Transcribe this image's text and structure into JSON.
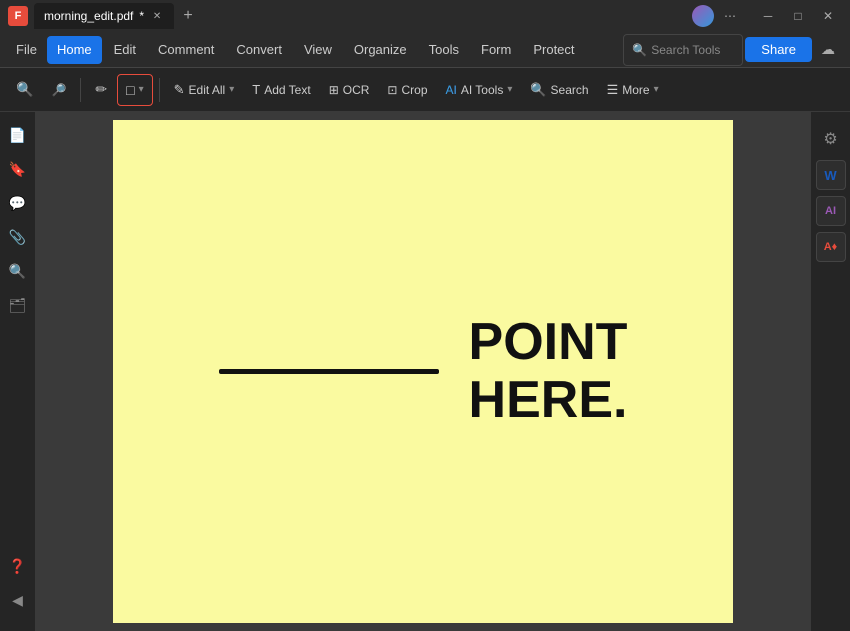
{
  "titlebar": {
    "app_logo": "F",
    "tab_name": "morning_edit.pdf",
    "tab_modified": "*",
    "new_tab_label": "+",
    "avatar_label": "user-avatar",
    "more_options_label": "⋯",
    "minimize_label": "─",
    "maximize_label": "□",
    "close_label": "✕"
  },
  "menubar": {
    "file_label": "File",
    "home_label": "Home",
    "edit_label": "Edit",
    "comment_label": "Comment",
    "convert_label": "Convert",
    "view_label": "View",
    "organize_label": "Organize",
    "tools_label": "Tools",
    "form_label": "Form",
    "protect_label": "Protect",
    "search_placeholder": "Search Tools",
    "share_label": "Share"
  },
  "toolbar": {
    "zoom_in_icon": "🔍",
    "zoom_out_icon": "🔎",
    "highlight_icon": "✏",
    "shape_icon": "□",
    "edit_all_label": "Edit All",
    "add_text_label": "Add Text",
    "ocr_label": "OCR",
    "crop_label": "Crop",
    "ai_tools_label": "AI Tools",
    "search_label": "Search",
    "more_label": "More"
  },
  "document": {
    "bg_color": "#fafaa0",
    "text_line1": "POINT",
    "text_line2": "HERE.",
    "line_present": true
  },
  "sidebar": {
    "icons": [
      "📄",
      "🔖",
      "💬",
      "📎",
      "🔍",
      "🗂"
    ],
    "bottom_icons": [
      "❓",
      "◀"
    ]
  },
  "right_panel": {
    "w_label": "W",
    "ai_label": "AI",
    "a_label": "A♦",
    "settings_icon": "⚙"
  }
}
